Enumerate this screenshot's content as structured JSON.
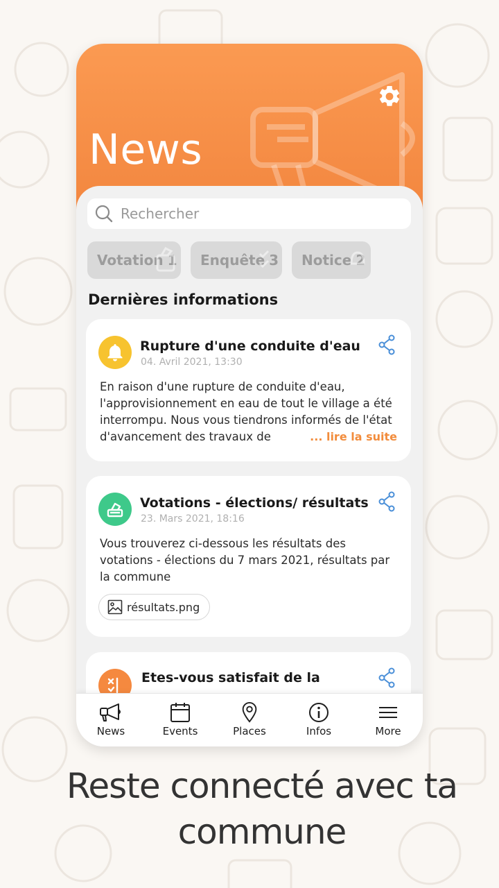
{
  "header": {
    "title": "News",
    "settings_icon": "gear-icon",
    "background_icon": "megaphone-icon",
    "accent_color": "#f5893f"
  },
  "search": {
    "placeholder": "Rechercher",
    "value": ""
  },
  "filters": [
    {
      "label": "Votation",
      "count": "1"
    },
    {
      "label": "Enquête",
      "count": "3"
    },
    {
      "label": "Notice",
      "count": "2"
    }
  ],
  "section_title": "Dernières informations",
  "news": [
    {
      "title": "Rupture d'une conduite d'eau",
      "date": "04. Avril 2021, 13:30",
      "icon": "bell-icon",
      "icon_color": "#f7c32f",
      "body": "En raison d'une rupture de conduite d'eau, l'approvisionnement en eau de tout le village a été interrompu. Nous vous tiendrons informés de l'état d'avancement des travaux de",
      "read_more": "... lire la suite"
    },
    {
      "title": "Votations - élections/ résultats",
      "date": "23. Mars 2021, 18:16",
      "icon": "ballot-box-icon",
      "icon_color": "#3ec98a",
      "body": "Vous trouverez ci-dessous les résultats des votations - élections du 7 mars 2021, résultats par la commune",
      "attachment": "résultats.png"
    },
    {
      "title": "Etes-vous satisfait de la",
      "icon": "checklist-icon",
      "icon_color": "#f5893f"
    }
  ],
  "bottom_nav": [
    {
      "label": "News",
      "icon": "megaphone-icon"
    },
    {
      "label": "Events",
      "icon": "calendar-icon"
    },
    {
      "label": "Places",
      "icon": "map-pin-icon"
    },
    {
      "label": "Infos",
      "icon": "info-icon"
    },
    {
      "label": "More",
      "icon": "hamburger-menu-icon"
    }
  ],
  "tagline": {
    "line1": "Reste connecté avec ta",
    "line2": "commune"
  }
}
